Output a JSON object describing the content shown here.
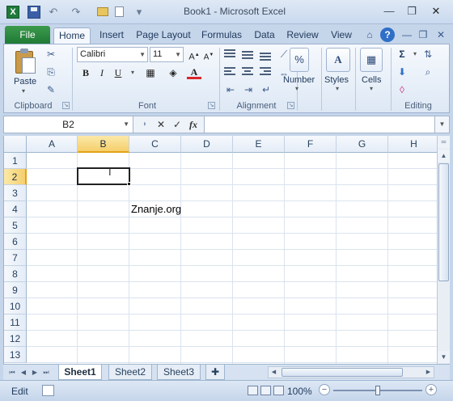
{
  "window": {
    "title": "Book1  -  Microsoft Excel",
    "min": "—",
    "restore": "❐",
    "close": "✕"
  },
  "qat": {
    "undo": "↶",
    "redo": "↷",
    "customize": "▾"
  },
  "ribbon_tabs": [
    "File",
    "Home",
    "Insert",
    "Page Layout",
    "Formulas",
    "Data",
    "Review",
    "View"
  ],
  "active_tab": "Home",
  "ribbon": {
    "clipboard": {
      "label": "Clipboard",
      "paste": "Paste"
    },
    "font": {
      "label": "Font",
      "name": "Calibri",
      "size": "11",
      "bold": "B",
      "italic": "I",
      "underline": "U",
      "color_letter": "A"
    },
    "alignment": {
      "label": "Alignment"
    },
    "number": {
      "label": "Number",
      "symbol": "%"
    },
    "styles": {
      "label": "Styles",
      "symbol": "A"
    },
    "cells": {
      "label": "Cells"
    },
    "editing": {
      "label": "Editing",
      "sum": "Σ"
    }
  },
  "formula_bar": {
    "name_box": "B2",
    "cancel": "✕",
    "enter": "✓",
    "fx": "fx",
    "value": ""
  },
  "grid": {
    "columns": [
      "A",
      "B",
      "C",
      "D",
      "E",
      "F",
      "G",
      "H"
    ],
    "rows": [
      "1",
      "2",
      "3",
      "4",
      "5",
      "6",
      "7",
      "8",
      "9",
      "10",
      "11",
      "12",
      "13"
    ],
    "selected_column": "B",
    "selected_row": "2",
    "cells": {
      "C4": "Znanje.org"
    }
  },
  "sheets": [
    "Sheet1",
    "Sheet2",
    "Sheet3"
  ],
  "active_sheet": "Sheet1",
  "status": {
    "mode": "Edit",
    "zoom": "100%"
  },
  "colors": {
    "file_tab": "#1f7a35",
    "selection_header": "#f5cf6c",
    "accent": "#1e395b"
  }
}
